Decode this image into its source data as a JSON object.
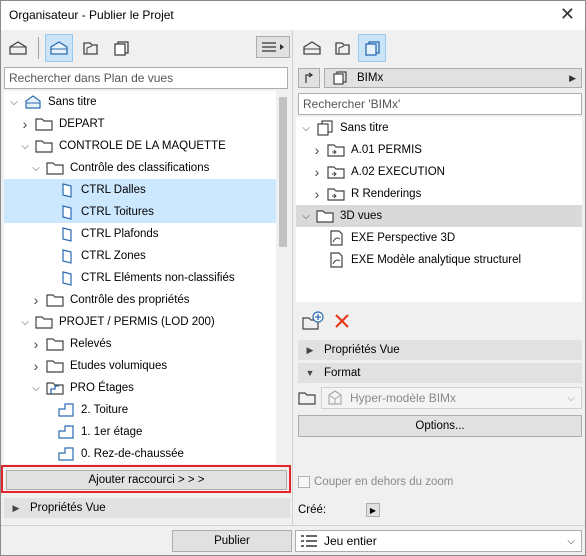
{
  "window": {
    "title": "Organisateur - Publier le Projet",
    "close_glyph": "✕"
  },
  "left": {
    "search_placeholder": "Rechercher dans Plan de vues",
    "tree": [
      {
        "label": "Sans titre",
        "icon": "project-icon",
        "chev": "v",
        "state": ""
      },
      {
        "label": "DEPART",
        "icon": "folder-icon",
        "chev": ">",
        "state": ""
      },
      {
        "label": "CONTROLE DE LA MAQUETTE",
        "icon": "folder-icon",
        "chev": "v",
        "state": ""
      },
      {
        "label": "Contrôle des classifications",
        "icon": "folder-icon",
        "chev": "v",
        "state": ""
      },
      {
        "label": "CTRL Dalles",
        "icon": "3d-view-icon",
        "chev": "",
        "state": "sel"
      },
      {
        "label": "CTRL Toitures",
        "icon": "3d-view-icon",
        "chev": "",
        "state": "sel"
      },
      {
        "label": "CTRL Plafonds",
        "icon": "3d-view-icon",
        "chev": "",
        "state": ""
      },
      {
        "label": "CTRL Zones",
        "icon": "3d-view-icon",
        "chev": "",
        "state": ""
      },
      {
        "label": "CTRL Eléments non-classifiés",
        "icon": "3d-view-icon",
        "chev": "",
        "state": ""
      },
      {
        "label": "Contrôle des propriétés",
        "icon": "folder-icon",
        "chev": ">",
        "state": ""
      },
      {
        "label": "PROJET / PERMIS (LOD 200)",
        "icon": "folder-icon",
        "chev": "v",
        "state": ""
      },
      {
        "label": "Relevés",
        "icon": "folder-icon",
        "chev": ">",
        "state": ""
      },
      {
        "label": "Etudes volumiques",
        "icon": "folder-icon",
        "chev": ">",
        "state": ""
      },
      {
        "label": "PRO Étages",
        "icon": "story-folder-icon",
        "chev": "v",
        "state": ""
      },
      {
        "label": "2. Toiture",
        "icon": "story-icon",
        "chev": "",
        "state": ""
      },
      {
        "label": "1. 1er étage",
        "icon": "story-icon",
        "chev": "",
        "state": ""
      },
      {
        "label": "0. Rez-de-chaussée",
        "icon": "story-icon",
        "chev": "",
        "state": ""
      }
    ],
    "add_shortcut_label": "Ajouter raccourci > > >",
    "properties_label": "Propriétés Vue"
  },
  "right": {
    "set_name": "BIMx",
    "search_placeholder": "Rechercher 'BIMx'",
    "tree": [
      {
        "label": "Sans titre",
        "icon": "publisher-set-icon",
        "chev": "v",
        "state": ""
      },
      {
        "label": "A.01 PERMIS",
        "icon": "subset-folder-icon",
        "chev": ">",
        "state": ""
      },
      {
        "label": "A.02 EXECUTION",
        "icon": "subset-folder-icon",
        "chev": ">",
        "state": ""
      },
      {
        "label": "R Renderings",
        "icon": "subset-folder-icon",
        "chev": ">",
        "state": ""
      },
      {
        "label": "3D vues",
        "icon": "folder-icon",
        "chev": "v",
        "state": "gsel"
      },
      {
        "label": "EXE Perspective 3D",
        "icon": "layout-item-icon",
        "chev": "",
        "state": ""
      },
      {
        "label": "EXE Modèle analytique structurel",
        "icon": "layout-item-icon",
        "chev": "",
        "state": ""
      }
    ],
    "properties_label": "Propriétés Vue",
    "format_label": "Format",
    "format_value": "Hyper-modèle BIMx",
    "options_label": "Options...",
    "clip_label": "Couper en dehors du zoom",
    "created_label": "Créé:",
    "scope_value": "Jeu entier"
  },
  "footer": {
    "publish_label": "Publier"
  },
  "colors": {
    "accent": "#cce4f7",
    "selection": "#cce8ff",
    "highlight_frame": "#e0262b",
    "delete": "#e8391d"
  }
}
